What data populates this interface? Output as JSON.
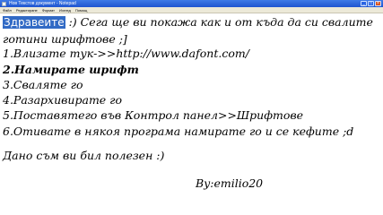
{
  "window": {
    "title": "Нов Текстов документ - Notepad",
    "minimize_label": "_",
    "maximize_label": "□",
    "close_label": "×"
  },
  "menu": [
    "Файл",
    "Редактиране",
    "Формат",
    "Изглед",
    "Помощ"
  ],
  "content": {
    "greeting_selected": "Здравеите",
    "line1_rest": ":) Сега ще ви покажа как и от къда да си свалите",
    "line2": "готини шрифтове ;]",
    "step1": "1.Влизате тук->>http://www.dafont.com/",
    "step2": "2.Намирате шрифт",
    "step3": "3.Сваляте го",
    "step4": "4.Разархивирате го",
    "step5": "5.Поставятего във Контрол панел>>Шрифтове",
    "step6": "6.Отивате в някоя програма намирате го и се кефите ;d",
    "closing": "Дано съм ви бил полезен :)",
    "signature": "By:emilio20"
  },
  "colors": {
    "selection": "#316ac5",
    "titlebar": "#1f55d0",
    "menubar": "#ece9d8"
  }
}
